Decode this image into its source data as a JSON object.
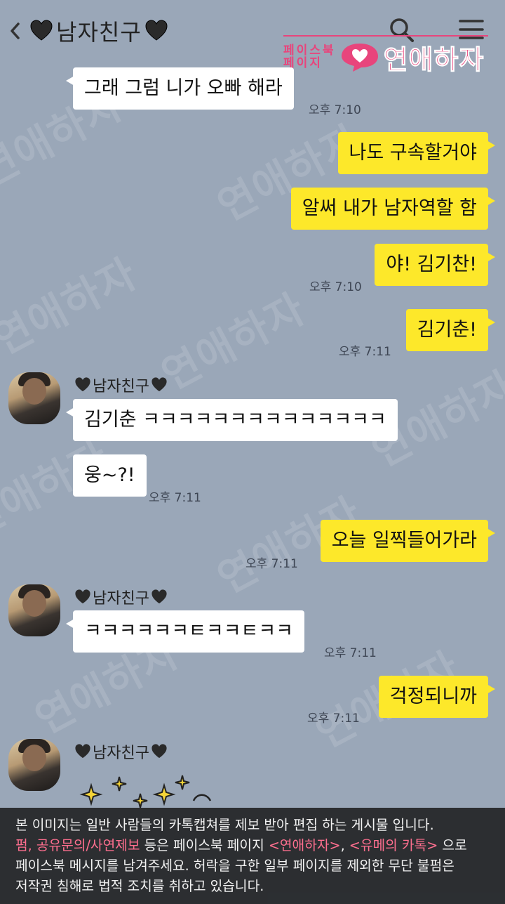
{
  "header": {
    "title": "남자친구",
    "brand_small_line1": "페이스북",
    "brand_small_line2": "페이지",
    "brand_name": "연애하자"
  },
  "background_watermark": "연애하자",
  "background_watermark_small": "페이스북 페이지",
  "messages": [
    {
      "id": "m1",
      "dir": "in",
      "text": "그래 그럼 니가 오빠 해라",
      "time": "오후 7:10"
    },
    {
      "id": "m2",
      "dir": "out",
      "text": "나도 구속할거야",
      "time": ""
    },
    {
      "id": "m3",
      "dir": "out",
      "text": "알써 내가 남자역할 함",
      "time": ""
    },
    {
      "id": "m4",
      "dir": "out",
      "text": "야! 김기찬!",
      "time": "오후 7:10"
    },
    {
      "id": "m5",
      "dir": "out",
      "text": "김기춘!",
      "time": "오후 7:11"
    },
    {
      "id": "m6",
      "dir": "in",
      "sender": "남자친구",
      "text": "김기춘 ㅋㅋㅋㅋㅋㅋㅋㅋㅋㅋㅋㅋㅋㅋ",
      "time": ""
    },
    {
      "id": "m7",
      "dir": "in",
      "text": "웅~?!",
      "time": "오후 7:11"
    },
    {
      "id": "m8",
      "dir": "out",
      "text": "오늘 일찍들어가라",
      "time": "오후 7:11"
    },
    {
      "id": "m9",
      "dir": "in",
      "sender": "남자친구",
      "text": "ㅋㅋㅋㅋㅋㅋㅌㅋㅋㅌㅋㅋ",
      "time": "오후 7:11"
    },
    {
      "id": "m10",
      "dir": "out",
      "text": "걱정되니까",
      "time": "오후 7:11"
    },
    {
      "id": "m11",
      "dir": "in",
      "sender": "남자친구",
      "text": "",
      "time": ""
    }
  ],
  "notice": {
    "line1": "본 이미지는 일반 사람들의 카톡캡쳐를 제보 받아 편집 하는 게시물 입니다.",
    "line2_pink": "펌, 공유문의/사연제보",
    "line2_mid": " 등은 페이스북 페이지 ",
    "line2_page1": "<연애하자>",
    "line2_sep": ", ",
    "line2_page2": "<유메의 카톡>",
    "line2_end": " 으로",
    "line3": "페이스북 메시지를 남겨주세요. 허락을 구한 일부 페이지를 제외한 무단 불펌은",
    "line4": "저작권 침해로 법적 조치를 취하고 있습니다."
  },
  "colors": {
    "background": "#9aa7b8",
    "bubble_out": "#fde82a",
    "bubble_in": "#ffffff",
    "brand_pink": "#e8457c"
  },
  "icons": [
    "back-icon",
    "black-heart-icon",
    "search-icon",
    "menu-icon",
    "sparkle-emoticon"
  ]
}
